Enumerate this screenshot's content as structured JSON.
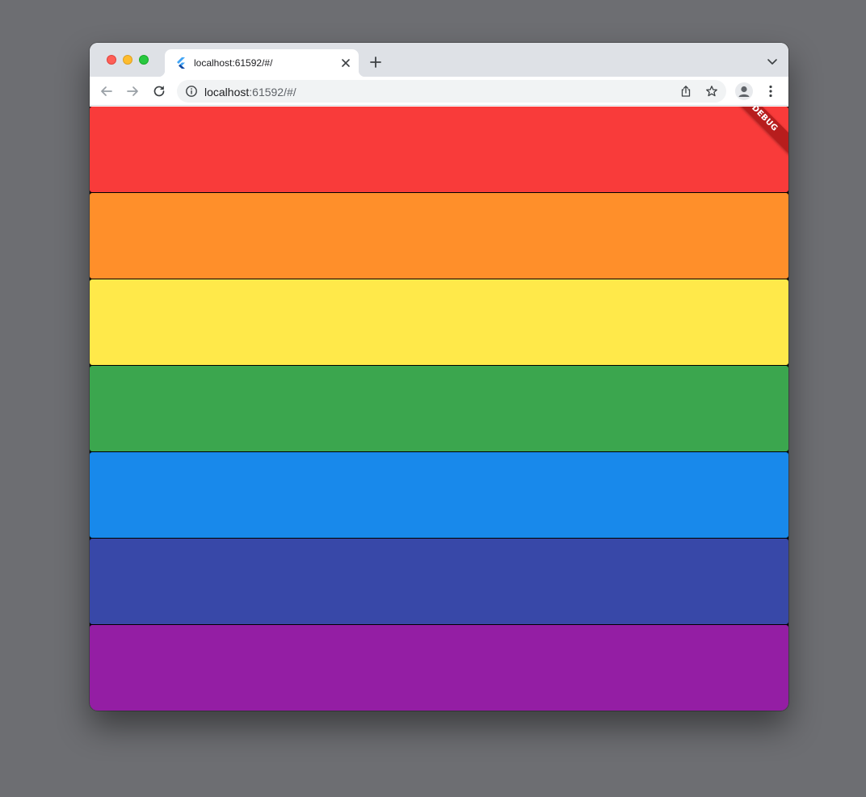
{
  "browser": {
    "tab": {
      "title": "localhost:61592/#/",
      "favicon": "flutter-logo-icon"
    },
    "address_bar": {
      "host": "localhost",
      "rest": ":61592/#/"
    },
    "icons": {
      "back": "arrow-left-icon",
      "forward": "arrow-right-icon",
      "reload": "reload-icon",
      "site_info": "info-icon",
      "share": "share-icon",
      "bookmark": "star-icon",
      "profile": "person-icon",
      "menu": "vertical-dots-icon",
      "new_tab": "plus-icon",
      "tab_search": "chevron-down-icon",
      "close_tab": "close-icon"
    }
  },
  "app": {
    "debug_banner": "DEBUG",
    "stripes": [
      {
        "name": "red",
        "color": "#f93b3a"
      },
      {
        "name": "orange",
        "color": "#ff8f2a"
      },
      {
        "name": "yellow",
        "color": "#ffe94a"
      },
      {
        "name": "green",
        "color": "#3ba64e"
      },
      {
        "name": "blue",
        "color": "#1889eb"
      },
      {
        "name": "indigo",
        "color": "#3848a8"
      },
      {
        "name": "purple",
        "color": "#941ea4"
      }
    ]
  }
}
